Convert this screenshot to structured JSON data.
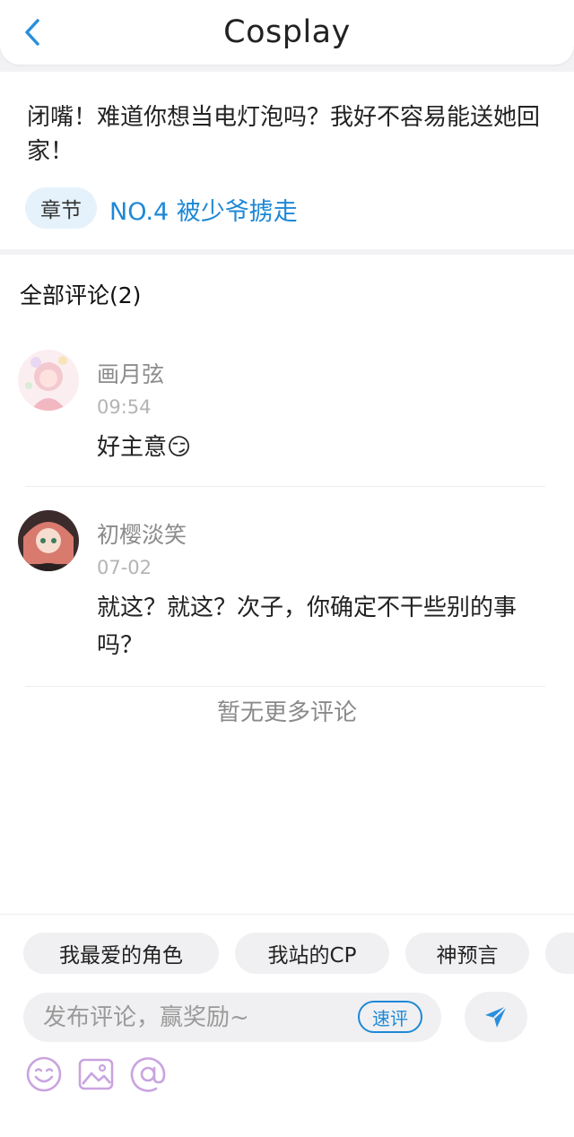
{
  "header": {
    "title": "Cosplay"
  },
  "quote": {
    "text": "闭嘴！难道你想当电灯泡吗？我好不容易能送她回家！",
    "chapter_tag": "章节",
    "chapter_title": "NO.4 被少爷掳走"
  },
  "comments": {
    "heading": "全部评论(2)",
    "items": [
      {
        "name": "画月弦",
        "time": "09:54",
        "text": "好主意😏"
      },
      {
        "name": "初樱淡笑",
        "time": "07-02",
        "text": "就这？就这？次子，你确定不干些别的事吗？"
      }
    ],
    "no_more": "暂无更多评论"
  },
  "bottom": {
    "chips": [
      "我最爱的角色",
      "我站的CP",
      "神预言"
    ],
    "input_placeholder": "发布评论，赢奖励~",
    "quick_label": "速评"
  },
  "colors": {
    "accent": "#1e88d6",
    "icon_purple": "#c9a4e0"
  }
}
